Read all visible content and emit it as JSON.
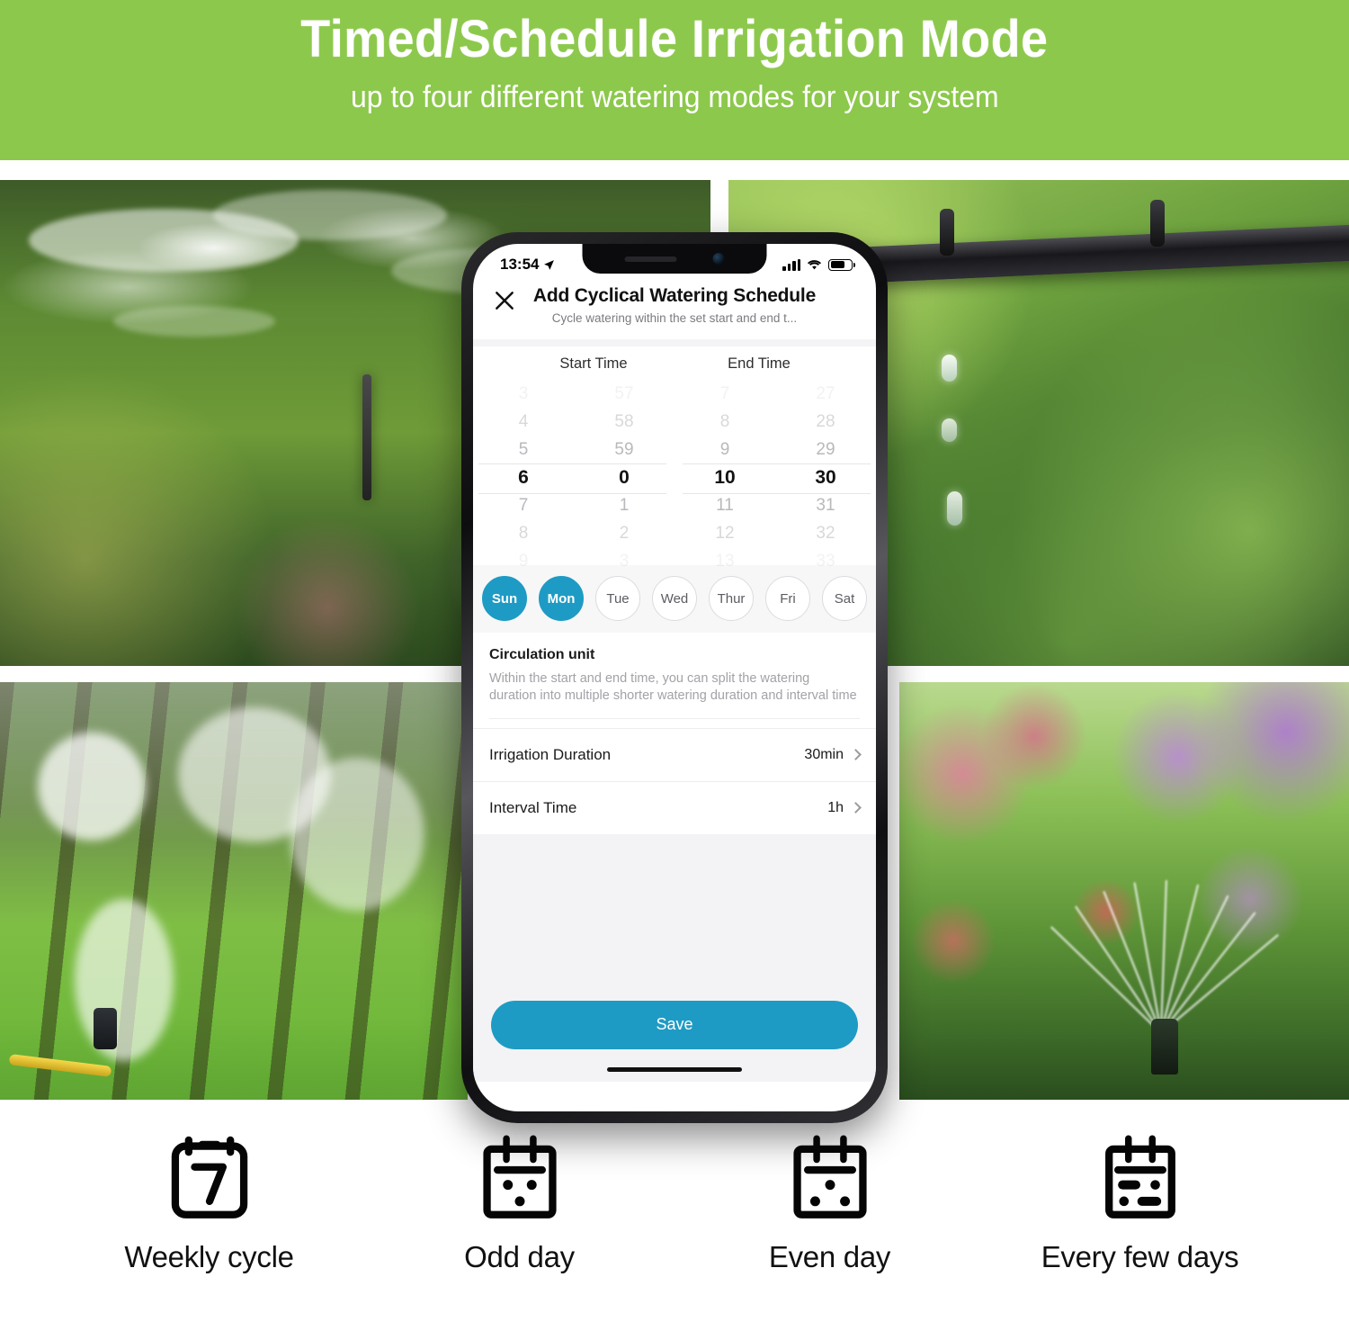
{
  "hero": {
    "title": "Timed/Schedule Irrigation Mode",
    "subtitle": "up to four different watering modes for your system",
    "bg_color": "#8cc84b"
  },
  "phone": {
    "status_bar": {
      "time": "13:54",
      "location_icon": "location-arrow-icon",
      "signal_icon": "cellular-signal-icon",
      "wifi_icon": "wifi-icon",
      "battery_icon": "battery-icon"
    },
    "app_header": {
      "close_icon": "close-x-icon",
      "title": "Add Cyclical Watering Schedule",
      "subtitle": "Cycle watering within the set start and end t..."
    },
    "time_picker": {
      "start_label": "Start Time",
      "end_label": "End Time",
      "start_hour": {
        "values": [
          "3",
          "4",
          "5",
          "6",
          "7",
          "8",
          "9"
        ],
        "selected_index": 3,
        "selected": "6"
      },
      "start_minute": {
        "values": [
          "57",
          "58",
          "59",
          "0",
          "1",
          "2",
          "3"
        ],
        "selected_index": 3,
        "selected": "0"
      },
      "end_hour": {
        "values": [
          "7",
          "8",
          "9",
          "10",
          "11",
          "12",
          "13"
        ],
        "selected_index": 3,
        "selected": "10"
      },
      "end_minute": {
        "values": [
          "27",
          "28",
          "29",
          "30",
          "31",
          "32",
          "33"
        ],
        "selected_index": 3,
        "selected": "30"
      }
    },
    "days": [
      {
        "label": "Sun",
        "selected": true
      },
      {
        "label": "Mon",
        "selected": true
      },
      {
        "label": "Tue",
        "selected": false
      },
      {
        "label": "Wed",
        "selected": false
      },
      {
        "label": "Thur",
        "selected": false
      },
      {
        "label": "Fri",
        "selected": false
      },
      {
        "label": "Sat",
        "selected": false
      }
    ],
    "circulation": {
      "title": "Circulation unit",
      "description": "Within the start and end time, you can split the watering duration into multiple shorter watering duration and interval time"
    },
    "rows": [
      {
        "label": "Irrigation Duration",
        "value": "30min"
      },
      {
        "label": "Interval Time",
        "value": "1h"
      }
    ],
    "save_label": "Save",
    "accent_color": "#1e9bc4"
  },
  "modes": [
    {
      "label": "Weekly cycle",
      "icon": "calendar-seven-icon"
    },
    {
      "label": "Odd day",
      "icon": "calendar-odd-day-icon"
    },
    {
      "label": "Even day",
      "icon": "calendar-even-day-icon"
    },
    {
      "label": "Every few days",
      "icon": "calendar-every-few-days-icon"
    }
  ]
}
